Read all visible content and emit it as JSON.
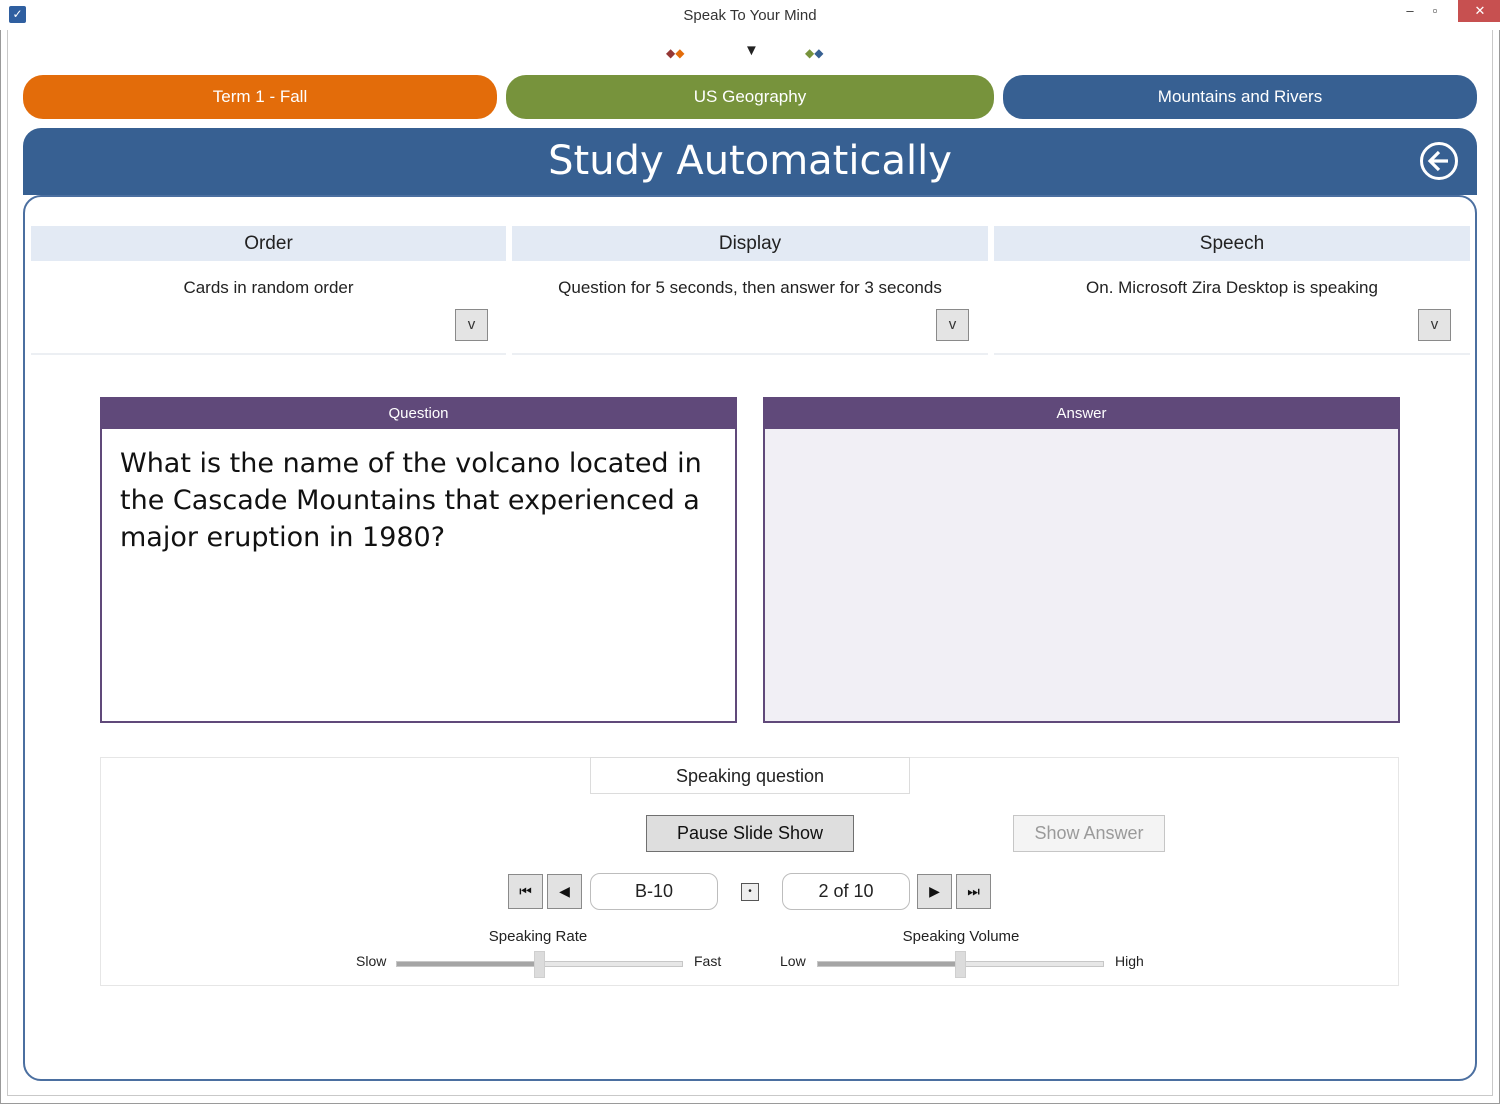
{
  "window": {
    "title": "Speak To Your Mind",
    "icon": "app-logo-icon"
  },
  "indicators": {
    "left": "◆◆",
    "middle": "▼",
    "right": "◆◆",
    "colors": [
      "#953735",
      "#e36c0a",
      "#77933c",
      "#376092"
    ]
  },
  "breadcrumbs": [
    {
      "label": "Term 1 - Fall",
      "color": "#e36c0a"
    },
    {
      "label": "US Geography",
      "color": "#77933c"
    },
    {
      "label": "Mountains and Rivers",
      "color": "#376092"
    }
  ],
  "header": {
    "title": "Study Automatically",
    "back_icon": "back-arrow-icon",
    "color": "#376092"
  },
  "settings": [
    {
      "heading": "Order",
      "value": "Cards in random order",
      "dropdown": "v"
    },
    {
      "heading": "Display",
      "value": "Question for 5 seconds, then answer for 3 seconds",
      "dropdown": "v"
    },
    {
      "heading": "Speech",
      "value": "On.  Microsoft Zira Desktop is speaking",
      "dropdown": "v"
    }
  ],
  "cards": {
    "question": {
      "label": "Question",
      "text": "What is the name of the volcano located in the Cascade Mountains that experienced a major eruption in 1980?"
    },
    "answer": {
      "label": "Answer",
      "text": ""
    },
    "accent": "#60497a"
  },
  "status": "Speaking question",
  "buttons": {
    "pause": "Pause Slide Show",
    "show_answer": "Show Answer"
  },
  "navigation": {
    "first": "⏮",
    "prev": "◀",
    "card_id": "B-10",
    "mark": "•",
    "position": "2 of 10",
    "next": "▶",
    "last": "⏭"
  },
  "sliders": {
    "rate": {
      "label": "Speaking Rate",
      "min_label": "Slow",
      "max_label": "Fast",
      "level": 0.5
    },
    "volume": {
      "label": "Speaking Volume",
      "min_label": "Low",
      "max_label": "High",
      "level": 0.5
    }
  }
}
